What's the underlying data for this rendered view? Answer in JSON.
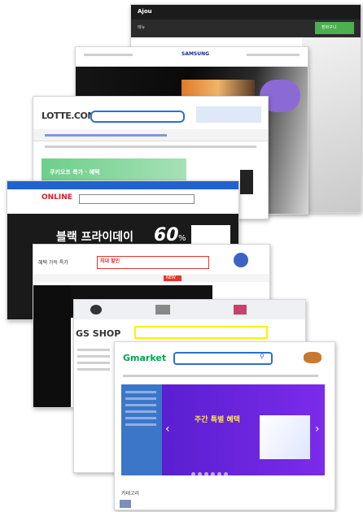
{
  "screens": {
    "s1": {
      "logo": "Ajou",
      "menu": "메뉴",
      "cta": "장바구니"
    },
    "s2": {
      "brand": "SAMSUNG"
    },
    "s3": {
      "logo": "LOTTE.COM",
      "banner": "쿠키오프 특가 · 혜택"
    },
    "s4": {
      "logo": "ONLINE",
      "promo_a": "블랙 프라이데이",
      "promo_b": "60",
      "promo_unit": "%"
    },
    "s5": {
      "promo": "혜택 가득 특가",
      "promo_2": "최대 할인",
      "badge": "NEW"
    },
    "s6": {
      "logo": "GS SHOP"
    },
    "s7": {
      "logo": "Gmarket",
      "banner": "주간 특별 혜택",
      "category_title": "카테고리"
    }
  },
  "colors": {
    "gs_yellow": "#fff100",
    "gmarket_green": "#00a651",
    "gmarket_purple": "#6d23d6",
    "lotte_red": "#e60012",
    "gs_green": "#00a650"
  }
}
